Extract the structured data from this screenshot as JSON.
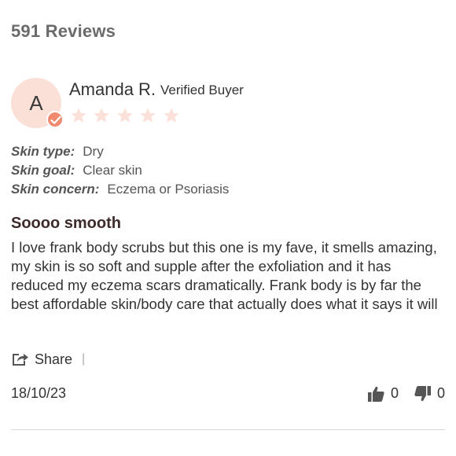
{
  "reviews_header": {
    "count_text": "591 Reviews"
  },
  "review": {
    "avatar_letter": "A",
    "reviewer_name": "Amanda R.",
    "verified_label": "Verified Buyer",
    "rating": {
      "value": 5,
      "max": 5
    },
    "attributes": [
      {
        "label": "Skin type:",
        "value": "Dry"
      },
      {
        "label": "Skin goal:",
        "value": "Clear skin"
      },
      {
        "label": "Skin concern:",
        "value": "Eczema or Psoriasis"
      }
    ],
    "title": "Soooo smooth",
    "body": "I love frank body scrubs but this one is my fave, it smells amazing, my skin is so soft and supple after the exfoliation and it has reduced my eczema scars dramatically. Frank body is by far the best affordable skin/body care that actually does what it says it will",
    "share_label": "Share",
    "share_separator": "|",
    "date": "18/10/23",
    "votes": {
      "up": "0",
      "down": "0"
    }
  },
  "colors": {
    "avatar_bg": "#fbe0d8",
    "badge": "#f08a6e",
    "star": "#fbe1d9",
    "header_text": "#6b6b6b"
  }
}
